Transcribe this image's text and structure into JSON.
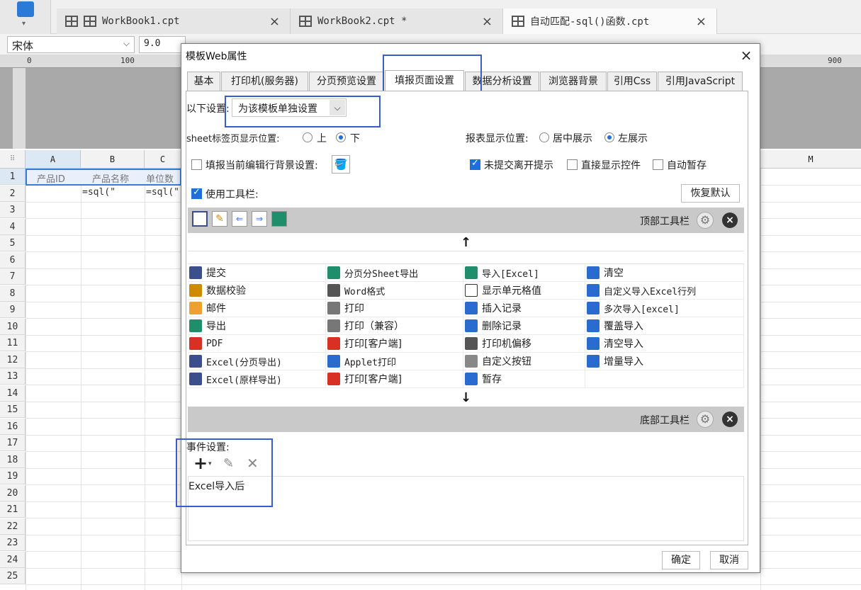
{
  "app": {
    "tabs": [
      {
        "label": "WorkBook1.cpt",
        "close": "×"
      },
      {
        "label": "WorkBook2.cpt *",
        "close": "×"
      },
      {
        "label": "自动匹配-sql()函数.cpt",
        "close": "×"
      }
    ],
    "font_family_value": "宋体",
    "font_size_value": "9.0",
    "ruler_labels": [
      "0",
      "100",
      "900"
    ],
    "columns": [
      "A",
      "B",
      "C",
      "M"
    ],
    "rows": [
      "1",
      "2",
      "3",
      "4",
      "5",
      "6",
      "7",
      "8",
      "9",
      "10",
      "11",
      "12",
      "13",
      "14",
      "15",
      "16",
      "17",
      "18",
      "19",
      "20",
      "21",
      "22",
      "23",
      "24",
      "25"
    ],
    "cells": {
      "a1": "产品ID",
      "b1": "产品名称",
      "c1": "单位数",
      "b2": "=sql(\"",
      "c2": "=sql(\""
    }
  },
  "dialog": {
    "title": "模板Web属性",
    "close": "×",
    "tabs": [
      "基本",
      "打印机(服务器)",
      "分页预览设置",
      "填报页面设置",
      "数据分析设置",
      "浏览器背景",
      "引用Css",
      "引用JavaScript"
    ],
    "active_tab": "填报页面设置",
    "settings_label": "以下设置:",
    "settings_value": "为该模板单独设置",
    "sheet_tab_pos_label": "sheet标签页显示位置:",
    "sheet_tab_pos_options": [
      "上",
      "下"
    ],
    "sheet_tab_pos_selected": "下",
    "report_pos_label": "报表显示位置:",
    "report_pos_options": [
      "居中展示",
      "左展示"
    ],
    "report_pos_selected": "左展示",
    "fill_row_bg_label": "填报当前编辑行背景设置:",
    "fill_row_bg_checked": false,
    "unsubmitted_label": "未提交离开提示",
    "unsubmitted_checked": true,
    "direct_controls_label": "直接显示控件",
    "direct_controls_checked": false,
    "auto_save_label": "自动暂存",
    "auto_save_checked": false,
    "use_toolbar_label": "使用工具栏:",
    "use_toolbar_checked": true,
    "restore_default": "恢复默认",
    "top_toolbar_label": "顶部工具栏",
    "bottom_toolbar_label": "底部工具栏",
    "up_arrow": "↑",
    "down_arrow": "↓",
    "items": [
      [
        "提交",
        "分页分Sheet导出",
        "导入[Excel]",
        "清空"
      ],
      [
        "数据校验",
        "Word格式",
        "显示单元格值",
        "自定义导入Excel行列"
      ],
      [
        "邮件",
        "打印",
        "插入记录",
        "多次导入[excel]"
      ],
      [
        "导出",
        "打印（兼容）",
        "删除记录",
        "覆盖导入"
      ],
      [
        "PDF",
        "打印[客户端]",
        "打印机偏移",
        "清空导入"
      ],
      [
        "Excel(分页导出)",
        "Applet打印",
        "自定义按钮",
        "增量导入"
      ],
      [
        "Excel(原样导出)",
        "打印[客户端]",
        "暂存",
        ""
      ]
    ],
    "event_label": "事件设置:",
    "event_item": "Excel导入后",
    "ok": "确定",
    "cancel": "取消"
  }
}
